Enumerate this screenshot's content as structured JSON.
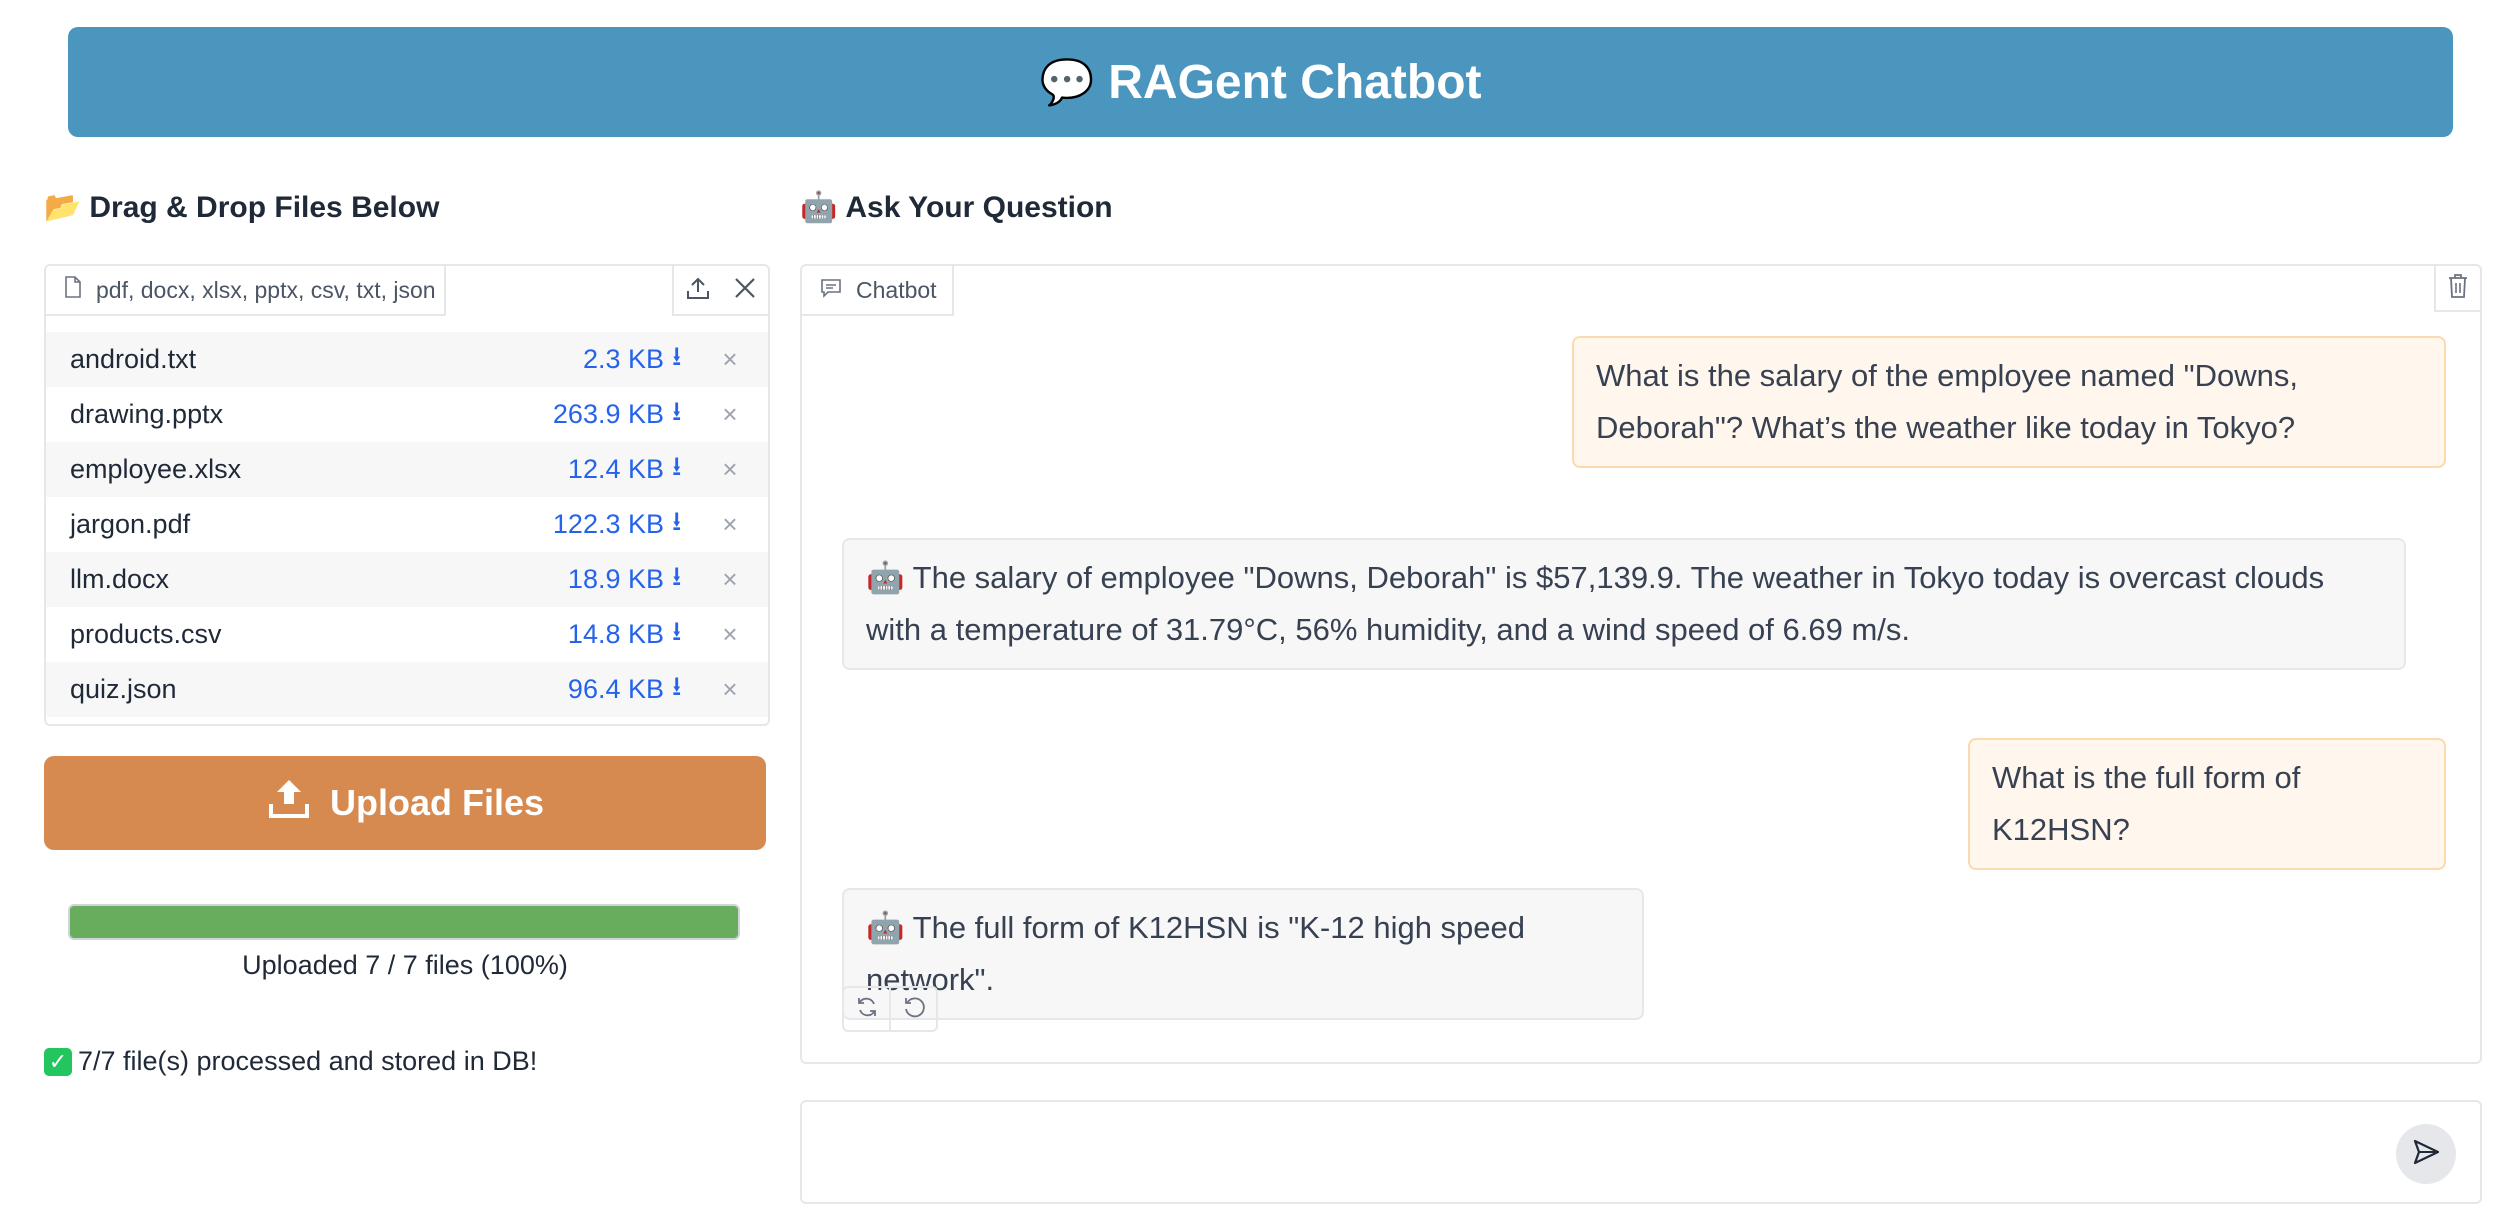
{
  "header": {
    "icon": "speech-bubble-icon",
    "title": "RAGent Chatbot"
  },
  "left": {
    "title": "Drag & Drop Files Below",
    "title_icon": "folder-icon",
    "file_types": "pdf, docx, xlsx, pptx, csv, txt, json",
    "files": [
      {
        "name": "android.txt",
        "size": "2.3 KB"
      },
      {
        "name": "drawing.pptx",
        "size": "263.9 KB"
      },
      {
        "name": "employee.xlsx",
        "size": "12.4 KB"
      },
      {
        "name": "jargon.pdf",
        "size": "122.3 KB"
      },
      {
        "name": "llm.docx",
        "size": "18.9 KB"
      },
      {
        "name": "products.csv",
        "size": "14.8 KB"
      },
      {
        "name": "quiz.json",
        "size": "96.4 KB"
      }
    ],
    "upload_label": "Upload Files",
    "progress": {
      "fraction": 1.0,
      "text": "Uploaded 7 / 7 files (100%)"
    },
    "status": "7/7 file(s) processed and stored in DB!"
  },
  "right": {
    "title": "Ask Your Question",
    "title_icon": "robot-icon",
    "chat_tab": "Chatbot",
    "messages": [
      {
        "role": "user",
        "text": "What is the salary of the employee named \"Downs, Deborah\"? What’s the weather like today in Tokyo?"
      },
      {
        "role": "bot",
        "text": "The salary of employee \"Downs, Deborah\" is $57,139.9. The weather in Tokyo today is overcast clouds with a temperature of 31.79°C, 56% humidity, and a wind speed of 6.69 m/s."
      },
      {
        "role": "user",
        "text": "What is the full form of K12HSN?"
      },
      {
        "role": "bot",
        "text": "The full form of K12HSN is \"K-12 high speed network\"."
      }
    ],
    "input": {
      "value": "",
      "placeholder": ""
    }
  },
  "colors": {
    "header_bg": "#4a96bf",
    "upload_bg": "#d68a50",
    "progress_fill": "#68ad5e",
    "link_blue": "#2563eb"
  }
}
